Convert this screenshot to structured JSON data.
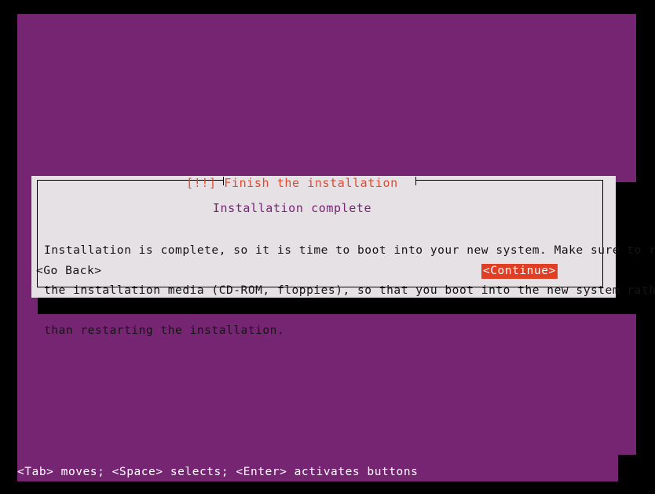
{
  "screen": {
    "background_color": "#000000",
    "console_color": "#762572"
  },
  "dialog": {
    "title": "[!!] Finish the installation",
    "title_color": "#e04a2f",
    "subtitle": "Installation complete",
    "subtitle_color": "#762572",
    "panel_color": "#e6e1e5",
    "body_lines": [
      "Installation is complete, so it is time to boot into your new system. Make sure to remove",
      "the installation media (CD-ROM, floppies), so that you boot into the new system rather",
      "than restarting the installation."
    ],
    "buttons": [
      {
        "label": "<Go Back>",
        "selected": false,
        "text_color": "#141414",
        "background_color": "transparent"
      },
      {
        "label": "<Continue>",
        "selected": true,
        "text_color": "#ffffff",
        "background_color": "#e03e25"
      }
    ]
  },
  "help_bar": {
    "text": "<Tab> moves; <Space> selects; <Enter> activates buttons",
    "text_color": "#ffffff"
  }
}
